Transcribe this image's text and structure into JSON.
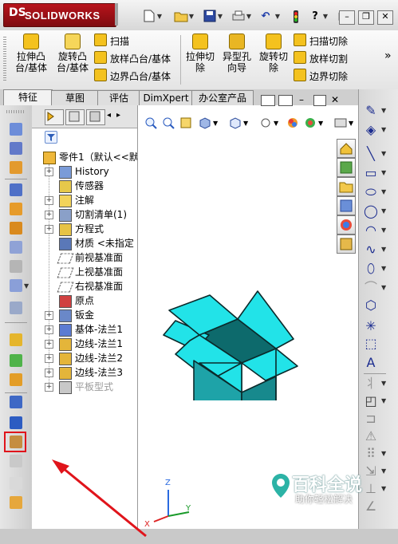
{
  "app": {
    "brand": "SOLIDWORKS",
    "brand_mark": "DS"
  },
  "title_bar": {
    "icons": [
      "new-document-icon",
      "open-file-icon",
      "save-icon",
      "print-icon",
      "undo-icon",
      "rebuild-icon",
      "help-icon",
      "options-icon"
    ],
    "window_controls": [
      "minimize",
      "restore",
      "close"
    ]
  },
  "command_manager": {
    "extrude_boss": "拉伸凸\n台/基体",
    "revolve_boss": "旋转凸\n台/基体",
    "sweep": "扫描",
    "loft_boss": "放样凸台/基体",
    "boundary_boss": "边界凸台/基体",
    "extrude_cut": "拉伸切\n除",
    "hole_wizard": "异型孔\n向导",
    "revolve_cut": "旋转切\n除",
    "swept_cut": "扫描切除",
    "lofted_cut": "放样切割",
    "boundary_cut": "边界切除",
    "more": "»"
  },
  "tabs": [
    {
      "label": "特征",
      "active": true
    },
    {
      "label": "草图",
      "active": false
    },
    {
      "label": "评估",
      "active": false
    },
    {
      "label": "DimXpert",
      "active": false
    },
    {
      "label": "办公室产品",
      "active": false
    }
  ],
  "feature_tree": {
    "root": "零件1（默认<<默",
    "items": [
      {
        "label": "History",
        "expandable": true,
        "icon": "history-icon"
      },
      {
        "label": "传感器",
        "expandable": false,
        "icon": "sensor-icon"
      },
      {
        "label": "注解",
        "expandable": true,
        "icon": "annotation-icon"
      },
      {
        "label": "切割清单(1)",
        "expandable": true,
        "icon": "cut-list-icon"
      },
      {
        "label": "方程式",
        "expandable": true,
        "icon": "equation-icon"
      },
      {
        "label": "材质 <未指定",
        "expandable": false,
        "icon": "material-icon"
      },
      {
        "label": "前视基准面",
        "expandable": false,
        "icon": "plane-icon"
      },
      {
        "label": "上视基准面",
        "expandable": false,
        "icon": "plane-icon"
      },
      {
        "label": "右视基准面",
        "expandable": false,
        "icon": "plane-icon"
      },
      {
        "label": "原点",
        "expandable": false,
        "icon": "origin-icon"
      },
      {
        "label": "钣金",
        "expandable": true,
        "icon": "sheet-metal-icon"
      },
      {
        "label": "基体-法兰1",
        "expandable": true,
        "icon": "base-flange-icon"
      },
      {
        "label": "边线-法兰1",
        "expandable": true,
        "icon": "edge-flange-icon"
      },
      {
        "label": "边线-法兰2",
        "expandable": true,
        "icon": "edge-flange-icon"
      },
      {
        "label": "边线-法兰3",
        "expandable": true,
        "icon": "edge-flange-icon"
      },
      {
        "label": "平板型式",
        "expandable": true,
        "icon": "flat-pattern-icon",
        "suppressed": true
      }
    ]
  },
  "triad": {
    "x": "X",
    "y": "Y",
    "z": "Z"
  },
  "watermark": {
    "main": "百科全说",
    "sub": "助你轻松解决"
  },
  "colors": {
    "model_top": "#22e3e8",
    "model_side": "#1ea3a8",
    "highlight": "#e0141b",
    "arrow": "#e0141b"
  }
}
